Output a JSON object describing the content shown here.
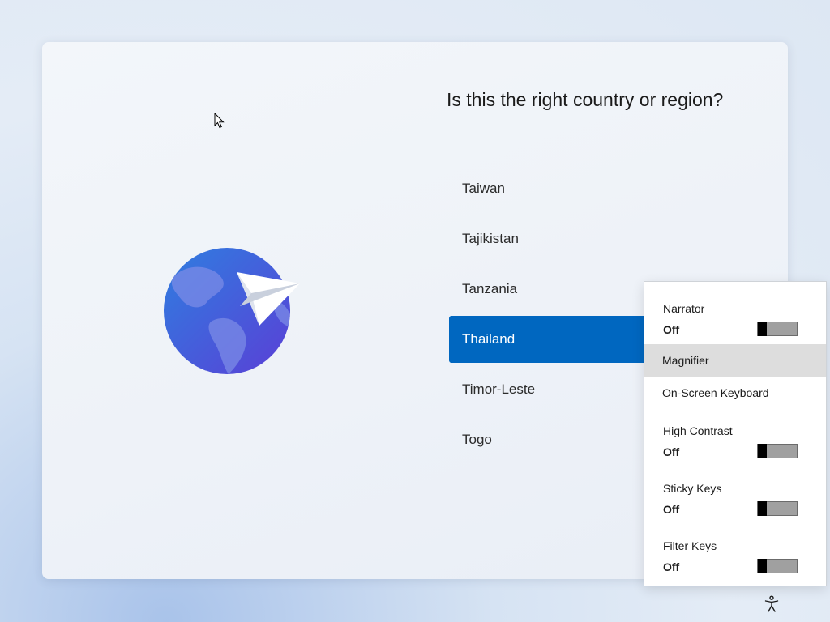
{
  "title": "Is this the right country or region?",
  "countries": [
    "Taiwan",
    "Tajikistan",
    "Tanzania",
    "Thailand",
    "Timor-Leste",
    "Togo"
  ],
  "selected_country": "Thailand",
  "accessibility_menu": {
    "narrator": {
      "label": "Narrator",
      "state": "Off"
    },
    "magnifier": {
      "label": "Magnifier"
    },
    "onscreen_keyboard": {
      "label": "On-Screen Keyboard"
    },
    "high_contrast": {
      "label": "High Contrast",
      "state": "Off"
    },
    "sticky_keys": {
      "label": "Sticky Keys",
      "state": "Off"
    },
    "filter_keys": {
      "label": "Filter Keys",
      "state": "Off"
    }
  },
  "colors": {
    "accent": "#0067c0",
    "hover": "#dddddd"
  },
  "icons": {
    "globe": "globe-icon",
    "paper_plane": "paper-plane-icon",
    "accessibility": "accessibility-icon",
    "cursor": "mouse-cursor-icon"
  }
}
